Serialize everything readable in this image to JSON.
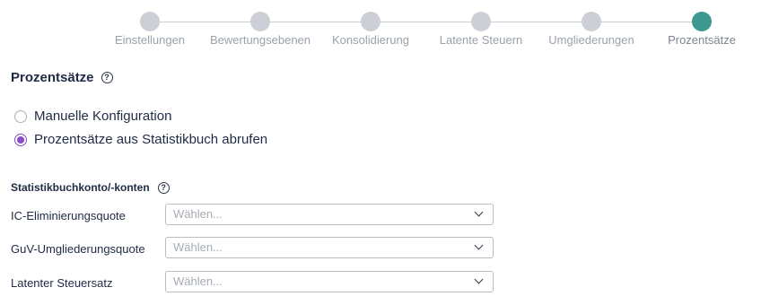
{
  "stepper": {
    "steps": [
      {
        "label": "Einstellungen",
        "active": false
      },
      {
        "label": "Bewertungsebenen",
        "active": false
      },
      {
        "label": "Konsolidierung",
        "active": false
      },
      {
        "label": "Latente Steuern",
        "active": false
      },
      {
        "label": "Umgliederungen",
        "active": false
      },
      {
        "label": "Prozentsätze",
        "active": true
      }
    ]
  },
  "section": {
    "title": "Prozentsätze",
    "help_icon": "help-circle-icon"
  },
  "radios": {
    "manual": {
      "label": "Manuelle Konfiguration",
      "checked": false
    },
    "statbook": {
      "label": "Prozentsätze aus Statistikbuch abrufen",
      "checked": true
    }
  },
  "accounts": {
    "title": "Statistikbuchkonto/-konten",
    "help_icon": "help-circle-icon",
    "fields": [
      {
        "label": "IC-Eliminierungsquote",
        "placeholder": "Wählen..."
      },
      {
        "label": "GuV-Umgliederungsquote",
        "placeholder": "Wählen..."
      },
      {
        "label": "Latenter Steuersatz",
        "placeholder": "Wählen..."
      }
    ]
  },
  "colors": {
    "accent": "#8a4cc8",
    "active_step": "#3d9890",
    "inactive_step": "#ccd0d6",
    "text": "#1f2a44"
  }
}
